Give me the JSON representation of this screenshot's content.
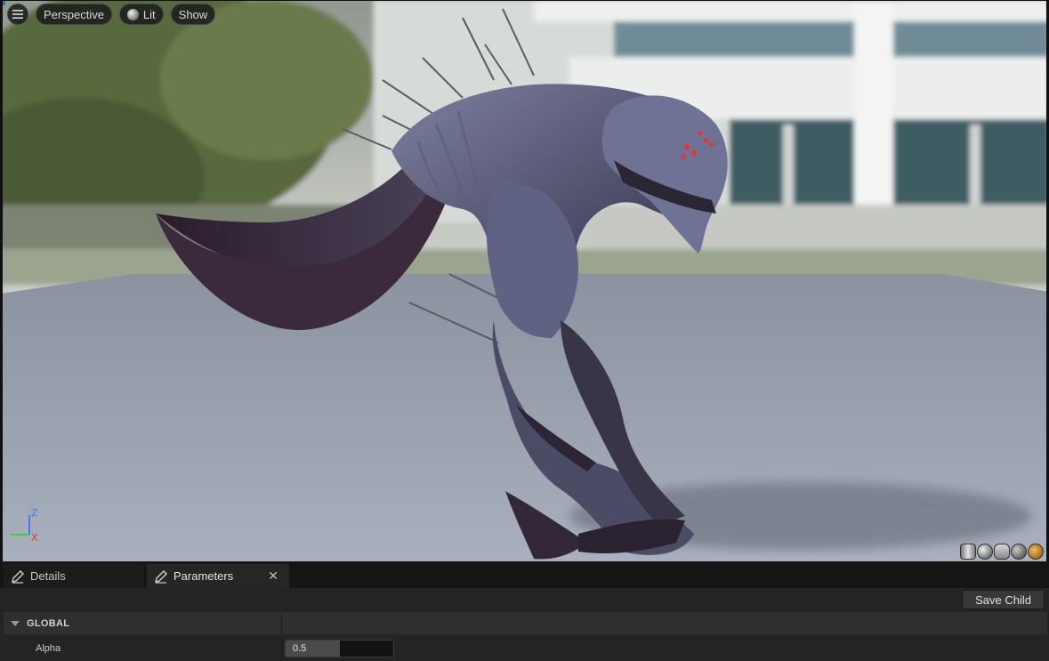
{
  "viewport": {
    "toolbar": {
      "menu_icon": "hamburger-icon",
      "perspective_label": "Perspective",
      "lit_label": "Lit",
      "lit_icon": "lit-sphere-icon",
      "show_label": "Show"
    },
    "axis_gizmo": {
      "z": "Z",
      "x": "X",
      "y": "Y"
    },
    "preview_shapes": [
      "cylinder-icon",
      "sphere-icon",
      "plane-icon",
      "cube-icon",
      "custom-mesh-icon"
    ],
    "colors": {
      "axis_x": "#e03535",
      "axis_y": "#3fd13f",
      "axis_z": "#3f7df0",
      "active_corner": "#2b6fd6"
    }
  },
  "tabs": [
    {
      "label": "Details",
      "icon": "pencil-icon",
      "active": false
    },
    {
      "label": "Parameters",
      "icon": "pencil-icon",
      "active": true,
      "close_icon": "close-icon"
    }
  ],
  "parameters": {
    "save_child_label": "Save Child",
    "category": {
      "label": "GLOBAL",
      "expanded": true
    },
    "rows": [
      {
        "label": "Alpha",
        "value": "0.5",
        "fill_fraction": 0.5
      }
    ]
  }
}
